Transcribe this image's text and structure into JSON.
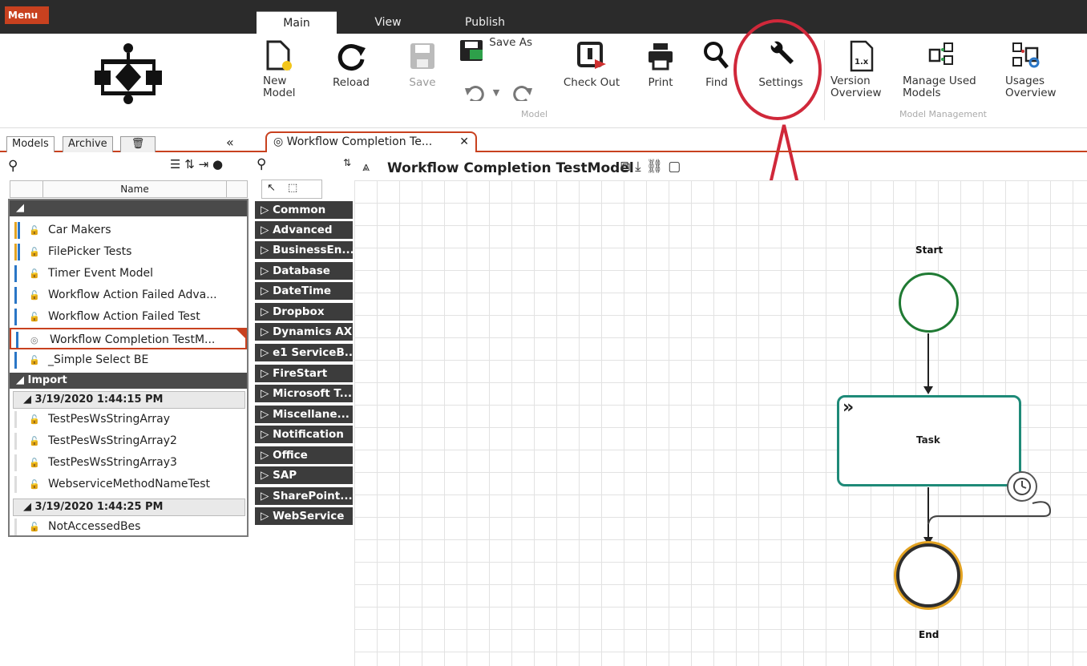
{
  "ribbon": {
    "menu_label": "Menu",
    "tabs": [
      "Main",
      "View",
      "Publish"
    ],
    "buttons": {
      "new_model": "New\nModel",
      "reload": "Reload",
      "save": "Save",
      "save_as": "Save As",
      "check_out": "Check Out",
      "print": "Print",
      "find": "Find",
      "settings": "Settings",
      "version_overview": "Version\nOverview",
      "manage_used_models": "Manage Used\nModels",
      "usages_overview": "Usages\nOverview"
    },
    "group_labels": {
      "model": "Model",
      "model_management": "Model Management"
    },
    "version_badge": "1.x"
  },
  "left_panel": {
    "tabs": [
      "Models",
      "Archive"
    ],
    "column_header": "Name",
    "models": [
      "Car Makers",
      "FilePicker Tests",
      "Timer Event Model",
      "Workflow Action Failed Adva...",
      "Workflow Action Failed Test",
      "Workflow Completion TestM...",
      "_Simple Select BE"
    ],
    "import_group": "Import",
    "import_sets": [
      {
        "date": "3/19/2020 1:44:15 PM",
        "items": [
          "TestPesWsStringArray",
          "TestPesWsStringArray2",
          "TestPesWsStringArray3",
          "WebserviceMethodNameTest"
        ]
      },
      {
        "date": "3/19/2020 1:44:25 PM",
        "items": [
          "NotAccessedBes"
        ]
      }
    ]
  },
  "toolbox": {
    "categories": [
      "Common",
      "Advanced",
      "BusinessEn...",
      "Database",
      "DateTime",
      "Dropbox",
      "Dynamics AX",
      "e1 ServiceB...",
      "FireStart",
      "Microsoft T...",
      "Miscellane...",
      "Notification",
      "Office",
      "SAP",
      "SharePoint...",
      "WebService"
    ]
  },
  "document": {
    "tab_title": "Workflow Completion Te...",
    "model_title": "Workflow Completion TestModel"
  },
  "diagram": {
    "start_label": "Start",
    "task_label": "Task",
    "end_label": "End"
  },
  "colors": {
    "accent": "#c8411f",
    "highlight": "#d0283a",
    "start": "#1f7a33",
    "task": "#1e8a78",
    "end_ring": "#e3a322"
  }
}
